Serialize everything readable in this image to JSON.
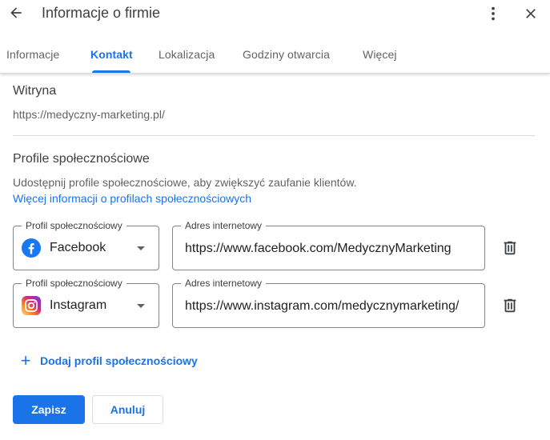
{
  "header": {
    "title": "Informacje o firmie",
    "back_icon": "arrow-back-icon",
    "more_icon": "more-vert-icon",
    "close_icon": "close-icon"
  },
  "tabs": [
    {
      "label": "Informacje",
      "active": false
    },
    {
      "label": "Kontakt",
      "active": true
    },
    {
      "label": "Lokalizacja",
      "active": false
    },
    {
      "label": "Godziny otwarcia",
      "active": false
    },
    {
      "label": "Więcej",
      "active": false
    }
  ],
  "website": {
    "label": "Witryna",
    "value": "https://medyczny-marketing.pl/"
  },
  "social": {
    "heading": "Profile społecznościowe",
    "description": "Udostępnij profile społecznościowe, aby zwiększyć zaufanie klientów.",
    "link": "Więcej informacji o profilach społecznościowych",
    "profiles": [
      {
        "profile_label": "Profil społecznościowy",
        "network": "Facebook",
        "icon": "facebook-icon",
        "url_label": "Adres internetowy",
        "url": "https://www.facebook.com/MedycznyMarketing"
      },
      {
        "profile_label": "Profil społecznościowy",
        "network": "Instagram",
        "icon": "instagram-icon",
        "url_label": "Adres internetowy",
        "url": "https://www.instagram.com/medycznymarketing/"
      }
    ],
    "add_label": "Dodaj profil społecznościowy"
  },
  "actions": {
    "save": "Zapisz",
    "cancel": "Anuluj"
  },
  "colors": {
    "accent": "#1a73e8",
    "facebook": "#1877f2"
  }
}
